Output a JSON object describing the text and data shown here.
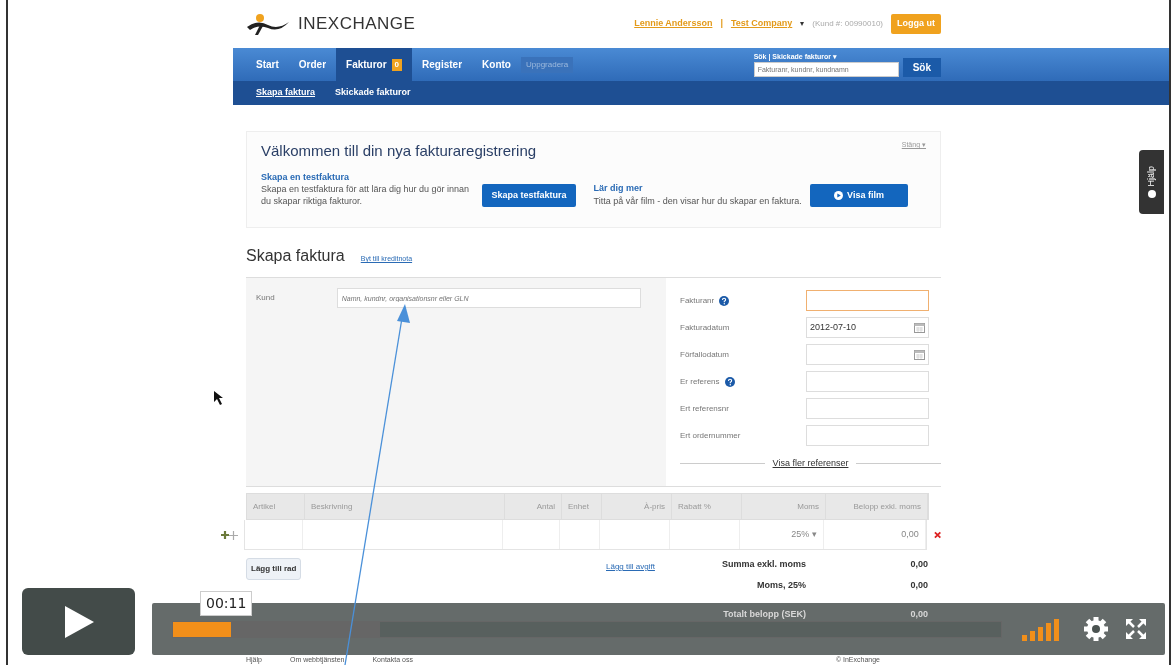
{
  "header": {
    "logo": "INEXCHANGE",
    "user": "Lennie Andersson",
    "separator": "|",
    "company": "Test Company",
    "caret": "▾",
    "customer_no": "(Kund #: 00990010)",
    "logout": "Logga ut"
  },
  "nav": {
    "items": [
      {
        "label": "Start",
        "selected": false
      },
      {
        "label": "Order",
        "selected": false
      },
      {
        "label": "Fakturor",
        "selected": true,
        "badge": "0"
      },
      {
        "label": "Register",
        "selected": false
      },
      {
        "label": "Konto",
        "selected": false
      }
    ],
    "upgrade": "Uppgradera",
    "search_label": "Sök | Skickade fakturor ▾",
    "search_placeholder": "Fakturanr, kundnr, kundnamn",
    "search_button": "Sök"
  },
  "subnav": [
    {
      "label": "Skapa faktura",
      "selected": true
    },
    {
      "label": "Skickade fakturor",
      "selected": false
    }
  ],
  "welcome": {
    "title": "Välkommen till din nya fakturaregistrering",
    "close": "Stäng ▾",
    "panels": [
      {
        "heading": "Skapa en testfaktura",
        "text": "Skapa en testfaktura för att lära dig hur du gör innan du skapar riktiga fakturor.",
        "button": "Skapa testfaktura",
        "icon": false
      },
      {
        "heading": "Lär dig mer",
        "text": "Titta på vår film - den visar hur du skapar en faktura.",
        "button": "Visa film",
        "icon": true
      }
    ]
  },
  "form": {
    "title": "Skapa faktura",
    "switch_link": "Byt till kreditnota",
    "customer_label": "Kund",
    "customer_placeholder": "Namn, kundnr, organisationsnr eller GLN",
    "fields": [
      {
        "label": "Fakturanr",
        "kind": "text",
        "help": true,
        "highlighted": true
      },
      {
        "label": "Fakturadatum",
        "kind": "date",
        "help": false,
        "highlighted": false,
        "value": "2012-07-10"
      },
      {
        "label": "Förfallodatum",
        "kind": "date",
        "help": false,
        "highlighted": false
      },
      {
        "label": "Er referens",
        "kind": "text",
        "help": true,
        "highlighted": false
      },
      {
        "label": "Ert referensnr",
        "kind": "text",
        "help": false,
        "highlighted": false
      },
      {
        "label": "Ert ordernummer",
        "kind": "text",
        "help": false,
        "highlighted": false
      }
    ],
    "more_refs": "Visa fler referenser"
  },
  "table": {
    "columns": [
      "Artikel",
      "Beskrivning",
      "Antal",
      "Enhet",
      "À-pris",
      "Rabatt %",
      "Moms",
      "Belopp exkl. moms"
    ],
    "rows": [
      {
        "vat": "25% ▾",
        "amount": "0,00"
      }
    ],
    "add_row": "Lägg till rad",
    "add_fee": "Lägg till avgift",
    "totals": [
      {
        "label": "Summa exkl. moms",
        "value": "0,00"
      },
      {
        "label": "Moms, 25%",
        "value": "0,00"
      },
      {
        "label": "Totalt belopp (SEK)",
        "value": "0,00"
      }
    ]
  },
  "footer": {
    "links": [
      "Hjälp",
      "Om webbtjänsten",
      "Kontakta oss"
    ],
    "copyright": "© InExchange"
  },
  "help_tab": "Hjälp",
  "player": {
    "time": "00:11",
    "level": 0.07
  }
}
